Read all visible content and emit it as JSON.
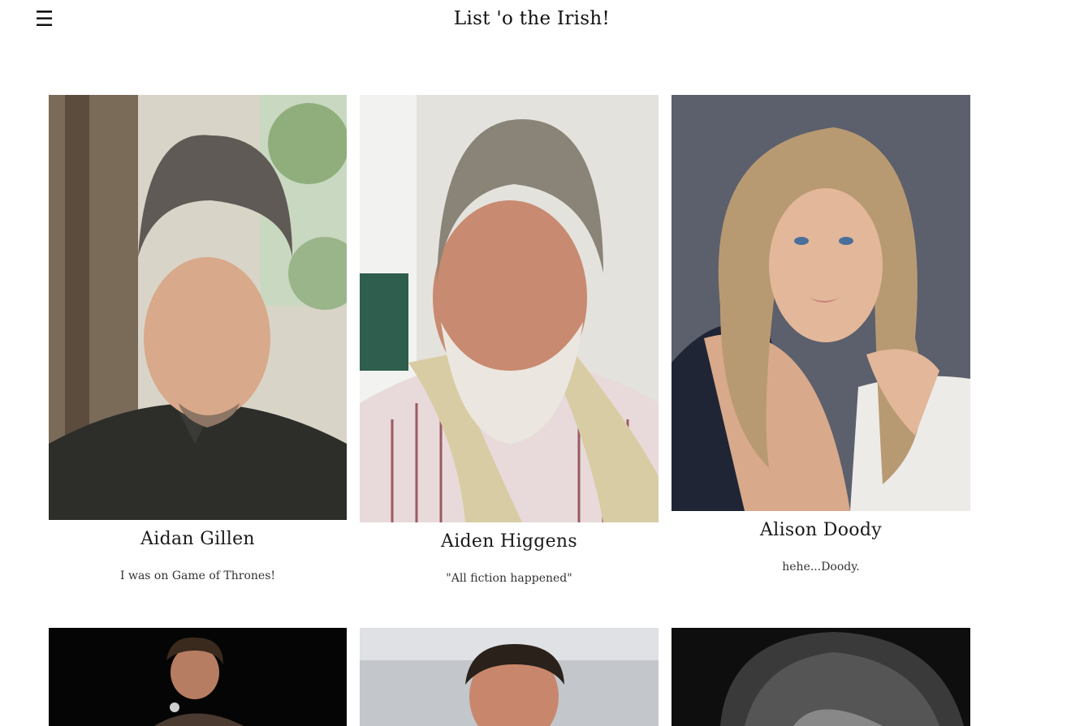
{
  "header": {
    "menu_icon": "☰",
    "title": "List 'o the Irish!"
  },
  "people": [
    {
      "name": "Aidan Gillen",
      "caption": "I was on Game of Thrones!",
      "photo_icon": "portrait-man-dark-shirt"
    },
    {
      "name": "Aiden Higgens",
      "caption": "\"All fiction happened\"",
      "photo_icon": "portrait-bearded-man"
    },
    {
      "name": "Alison Doody",
      "caption": "hehe...Doody.",
      "photo_icon": "portrait-woman-blonde"
    },
    {
      "name": "",
      "caption": "",
      "photo_icon": "portrait-man-microphone"
    },
    {
      "name": "",
      "caption": "",
      "photo_icon": "portrait-man-outdoors"
    },
    {
      "name": "",
      "caption": "",
      "photo_icon": "portrait-black-white"
    }
  ]
}
